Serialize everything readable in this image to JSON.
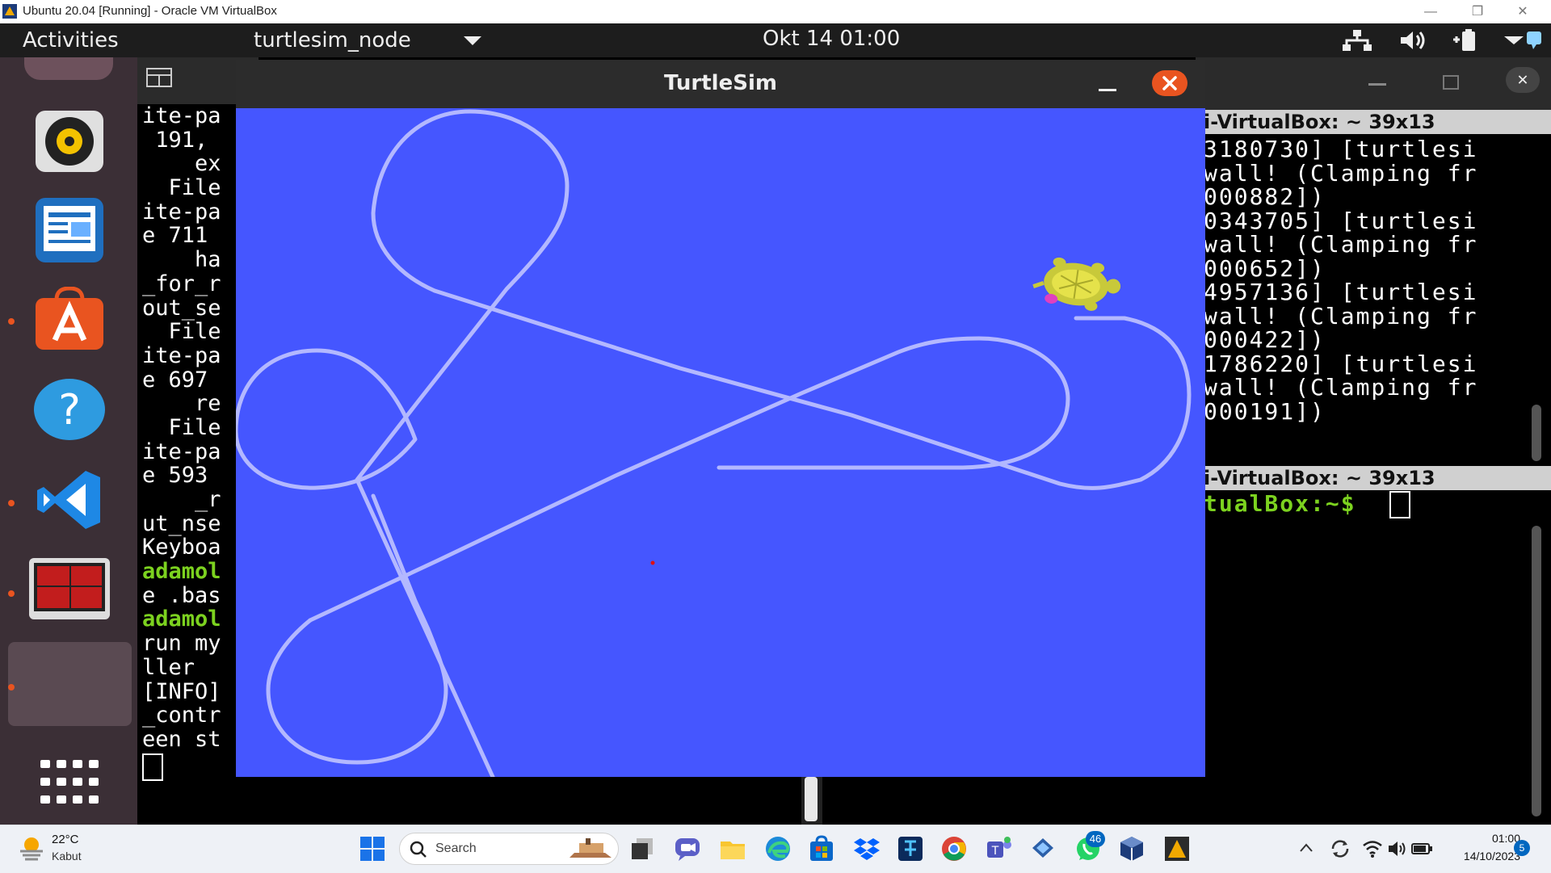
{
  "vbox": {
    "title": "Ubuntu 20.04 [Running] - Oracle VM VirtualBox",
    "controls": {
      "minimize": "—",
      "restore": "❐",
      "close": "✕"
    }
  },
  "ubuntu_topbar": {
    "activities": "Activities",
    "app_menu": "turtlesim_node",
    "clock": "Okt 14  01:00"
  },
  "dock": {
    "items": [
      "rhythmbox-icon",
      "libreoffice-writer-icon",
      "ubuntu-software-icon",
      "help-icon",
      "vscode-icon",
      "terminator-icon",
      "active-app-slot",
      "show-applications-icon"
    ]
  },
  "terminal_left": {
    "lines": [
      {
        "text": "ite-pa",
        "style": ""
      },
      {
        "text": " 191,",
        "style": ""
      },
      {
        "text": "    ex",
        "style": ""
      },
      {
        "text": "  File",
        "style": ""
      },
      {
        "text": "ite-pa",
        "style": ""
      },
      {
        "text": "e 711",
        "style": ""
      },
      {
        "text": "    ha",
        "style": ""
      },
      {
        "text": "_for_r",
        "style": ""
      },
      {
        "text": "out_se",
        "style": ""
      },
      {
        "text": "  File",
        "style": ""
      },
      {
        "text": "ite-pa",
        "style": ""
      },
      {
        "text": "e 697",
        "style": ""
      },
      {
        "text": "    re",
        "style": ""
      },
      {
        "text": "  File",
        "style": ""
      },
      {
        "text": "ite-pa",
        "style": ""
      },
      {
        "text": "e 593",
        "style": ""
      },
      {
        "text": "    _r",
        "style": ""
      },
      {
        "text": "ut_nse",
        "style": ""
      },
      {
        "text": "Keyboa",
        "style": ""
      },
      {
        "text": "adamol",
        "style": "green"
      },
      {
        "text": "e .bas",
        "style": ""
      },
      {
        "text": "adamol",
        "style": "green"
      },
      {
        "text": "run my",
        "style": ""
      },
      {
        "text": "ller",
        "style": ""
      },
      {
        "text": "[INFO]",
        "style": ""
      },
      {
        "text": "_contr",
        "style": ""
      },
      {
        "text": "een st",
        "style": ""
      }
    ]
  },
  "terminal_right": {
    "header_top": "i-VirtualBox: ~ 39x13",
    "lines_top": [
      "3180730] [turtlesi",
      "wall! (Clamping fr",
      "000882])",
      "0343705] [turtlesi",
      "wall! (Clamping fr",
      "000652])",
      "4957136] [turtlesi",
      "wall! (Clamping fr",
      "000422])",
      "1786220] [turtlesi",
      "wall! (Clamping fr",
      "000191])"
    ],
    "header_bottom": "i-VirtualBox: ~ 39x13",
    "prompt": "tualBox:~$ "
  },
  "turtlesim": {
    "title": "TurtleSim",
    "background": "#4556ff",
    "pen_color": "#b3b8ff"
  },
  "taskbar": {
    "weather_temp": "22°C",
    "weather_desc": "Kabut",
    "search_placeholder": "Search",
    "whatsapp_badge": "46",
    "time": "01:00",
    "date": "14/10/2023",
    "notification_count": "5"
  }
}
